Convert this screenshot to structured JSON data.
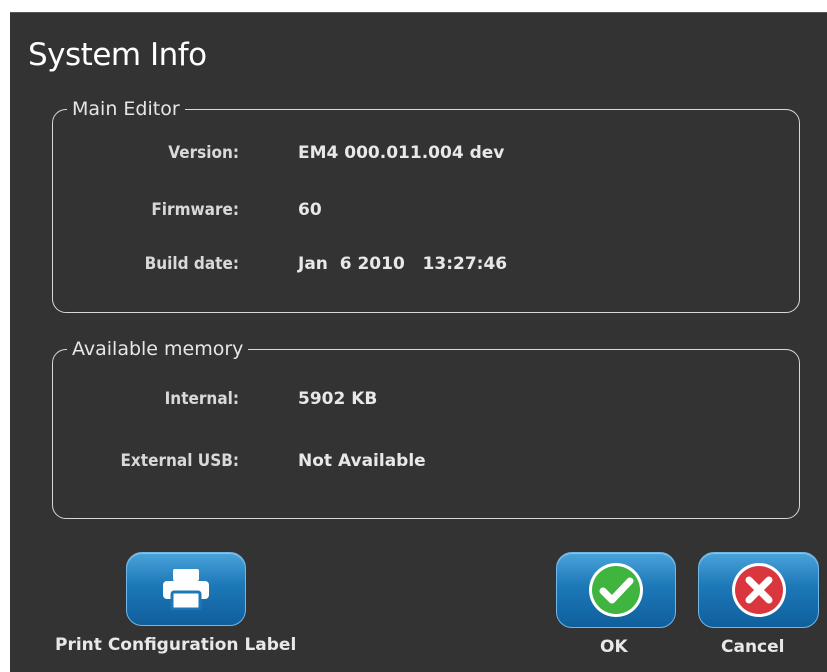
{
  "dialog": {
    "title": "System Info"
  },
  "main_editor": {
    "legend": "Main Editor",
    "version_label": "Version:",
    "version_value": "EM4 000.011.004 dev",
    "firmware_label": "Firmware:",
    "firmware_value": "60",
    "build_date_label": "Build date:",
    "build_date_value": "Jan  6 2010   13:27:46"
  },
  "available_memory": {
    "legend": "Available memory",
    "internal_label": "Internal:",
    "internal_value": "5902 KB",
    "external_usb_label": "External USB:",
    "external_usb_value": "Not Available"
  },
  "buttons": {
    "print_label": "Print Configuration Label",
    "print_icon": "printer-icon",
    "ok_label": "OK",
    "ok_icon": "check-icon",
    "cancel_label": "Cancel",
    "cancel_icon": "close-icon"
  },
  "colors": {
    "background": "#333333",
    "button_blue": "#1d78b7",
    "ok_green": "#3fb53f",
    "cancel_red": "#d9363e"
  }
}
